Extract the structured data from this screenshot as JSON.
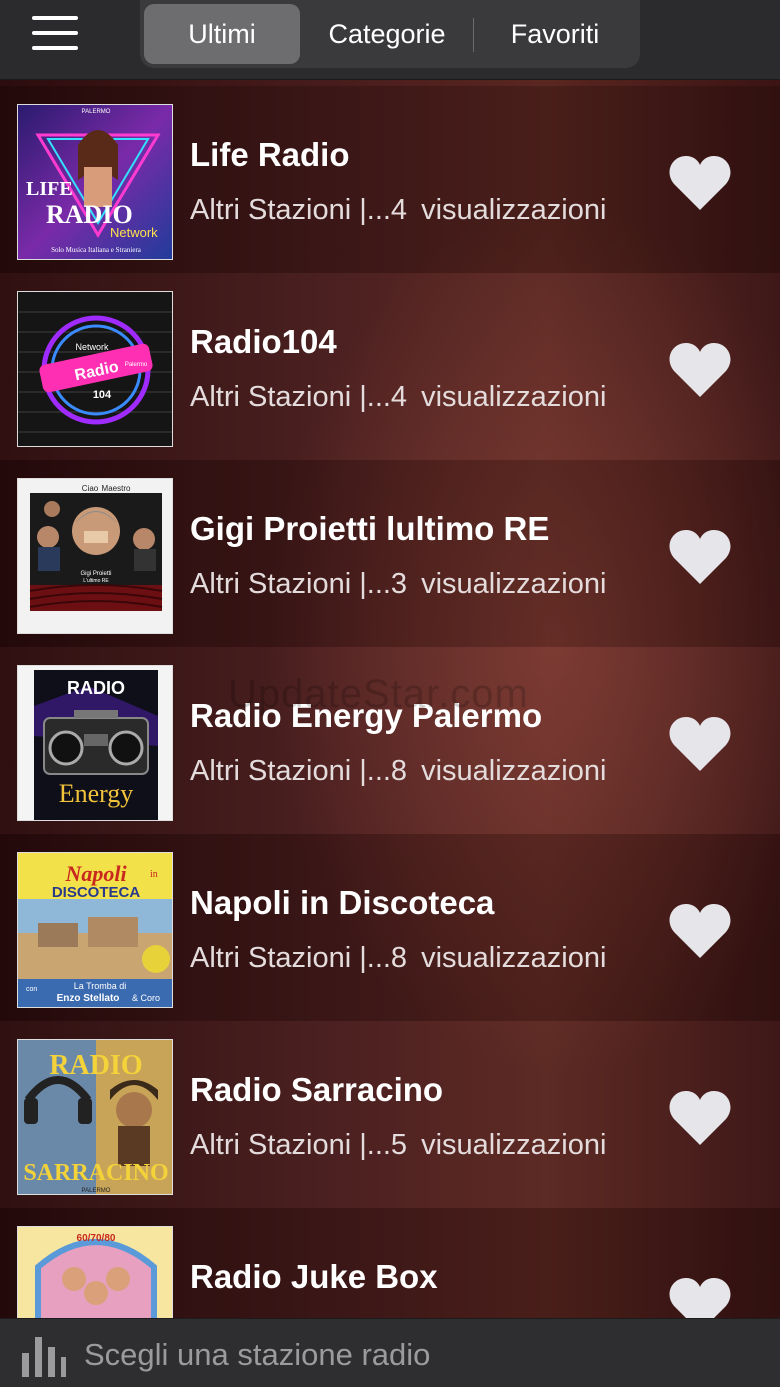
{
  "header": {
    "menu_icon": "hamburger-menu-icon",
    "tabs": [
      {
        "label": "Ultimi",
        "active": true
      },
      {
        "label": "Categorie",
        "active": false
      },
      {
        "label": "Favoriti",
        "active": false
      }
    ]
  },
  "stations": [
    {
      "title": "Life Radio",
      "category": "Altri Stazioni |...4",
      "views": "visualizzazioni"
    },
    {
      "title": "Radio104",
      "category": "Altri Stazioni |...4",
      "views": "visualizzazioni"
    },
    {
      "title": "Gigi Proietti lultimo RE",
      "category": "Altri Stazioni |...3",
      "views": "visualizzazioni"
    },
    {
      "title": "Radio Energy Palermo",
      "category": "Altri Stazioni |...8",
      "views": "visualizzazioni"
    },
    {
      "title": "Napoli in Discoteca",
      "category": "Altri Stazioni |...8",
      "views": "visualizzazioni"
    },
    {
      "title": "Radio Sarracino",
      "category": "Altri Stazioni |...5",
      "views": "visualizzazioni"
    },
    {
      "title": "Radio Juke Box",
      "category": "",
      "views": ""
    }
  ],
  "thumb_text": {
    "life": [
      "PALERMO",
      "LIFE",
      "RADIO",
      "Network",
      "Solo Musica Italiana e Straniera"
    ],
    "radio104": [
      "Network",
      "Radio",
      "Palermo",
      "104"
    ],
    "gigi": [
      "Ciao",
      "Maestro",
      "Gigi Proietti",
      "L'ultimo RE"
    ],
    "energy": [
      "RADIO",
      "Energy"
    ],
    "napoli": [
      "Napoli",
      "in",
      "DISCOTECA",
      "con",
      "La Tromba di",
      "Enzo Stellato",
      "& Coro"
    ],
    "sarracino": [
      "RADIO",
      "SARRACINO",
      "PALERMO"
    ],
    "jukebox": [
      "60/70/80"
    ]
  },
  "watermark": "UpdateStar.com",
  "player": {
    "icon": "equalizer-bars-icon",
    "text": "Scegli una stazione radio"
  },
  "colors": {
    "header_bg": "#2b2b2d",
    "active_tab": "#6d6d70",
    "heart": "#e6e6ea"
  }
}
